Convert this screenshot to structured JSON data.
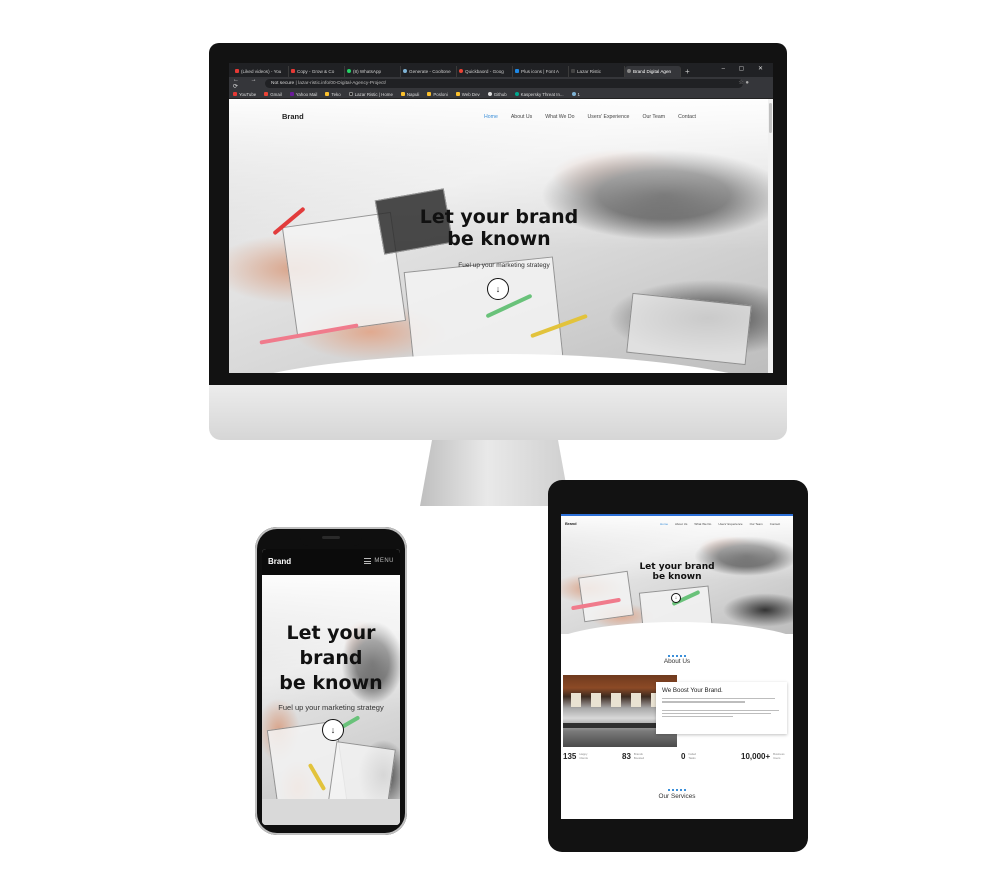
{
  "browser": {
    "tabs": [
      {
        "label": "(Liked videos) - You",
        "color": "#e53935"
      },
      {
        "label": "Copy - Grow & Co",
        "color": "#e53935"
      },
      {
        "label": "(8) WhatsApp",
        "color": "#25d366"
      },
      {
        "label": "Generate - Cooltone",
        "color": "#7fb3d5"
      },
      {
        "label": "Quickbaord - Goog",
        "color": "#ea4335"
      },
      {
        "label": "Plus icons | Font A",
        "color": "#1e88e5"
      },
      {
        "label": "Lazar Ristic",
        "color": "#444"
      },
      {
        "label": "Brand Digital Agen",
        "color": "#888"
      }
    ],
    "new_tab_symbol": "+",
    "window_controls": "– ▢ ✕",
    "nav_symbols": "← → ⟳",
    "security_label": "Not secure",
    "url": "lazar-ristic.info/00-Digital-Agency-Project/",
    "bookmarks": [
      {
        "label": "YouTube",
        "color": "#e53935"
      },
      {
        "label": "Gmail",
        "color": "#ea4335"
      },
      {
        "label": "Yahoo Mail",
        "color": "#6a1b9a"
      },
      {
        "label": "Teko",
        "color": "#fbc02d"
      },
      {
        "label": "Lazar Ristic | Home",
        "color": "#222"
      },
      {
        "label": "Napuli",
        "color": "#fbc02d"
      },
      {
        "label": "Posloni",
        "color": "#fbc02d"
      },
      {
        "label": "Web Dev",
        "color": "#fbc02d"
      },
      {
        "label": "Github",
        "color": "#ddd"
      },
      {
        "label": "Kaspersky Threat In...",
        "color": "#00a88e"
      },
      {
        "label": "1",
        "color": "#7fb3d5"
      }
    ]
  },
  "desktop_site": {
    "brand": "Brand",
    "nav": [
      "Home",
      "About Us",
      "What We Do",
      "Users' Experience",
      "Our Team",
      "Contact"
    ],
    "active_nav": "Home",
    "hero_title_line1": "Let your brand",
    "hero_title_line2": "be known",
    "hero_subtitle": "Fuel up your marketing strategy"
  },
  "phone_site": {
    "brand": "Brand",
    "menu_label": "MENU",
    "hero_title_line1": "Let your",
    "hero_title_line2": "brand",
    "hero_title_line3": "be known",
    "hero_subtitle": "Fuel up your marketing strategy"
  },
  "tablet_site": {
    "brand": "Brand",
    "nav": [
      "Home",
      "About Us",
      "What We Do",
      "Users' Experience",
      "Our Team",
      "Contact"
    ],
    "hero_title_line1": "Let your brand",
    "hero_title_line2": "be known",
    "about_heading": "About Us",
    "boost_heading": "We Boost Your Brand.",
    "stats": [
      {
        "value": "135",
        "label": "Happy Clients"
      },
      {
        "value": "83",
        "label": "Brands Boosted"
      },
      {
        "value": "0",
        "label": "Failed Tasks"
      },
      {
        "value": "10,000+",
        "label": "Business Users"
      }
    ],
    "services_heading": "Our Services"
  },
  "colors": {
    "accent": "#3b8fd9",
    "dark": "#111111"
  }
}
